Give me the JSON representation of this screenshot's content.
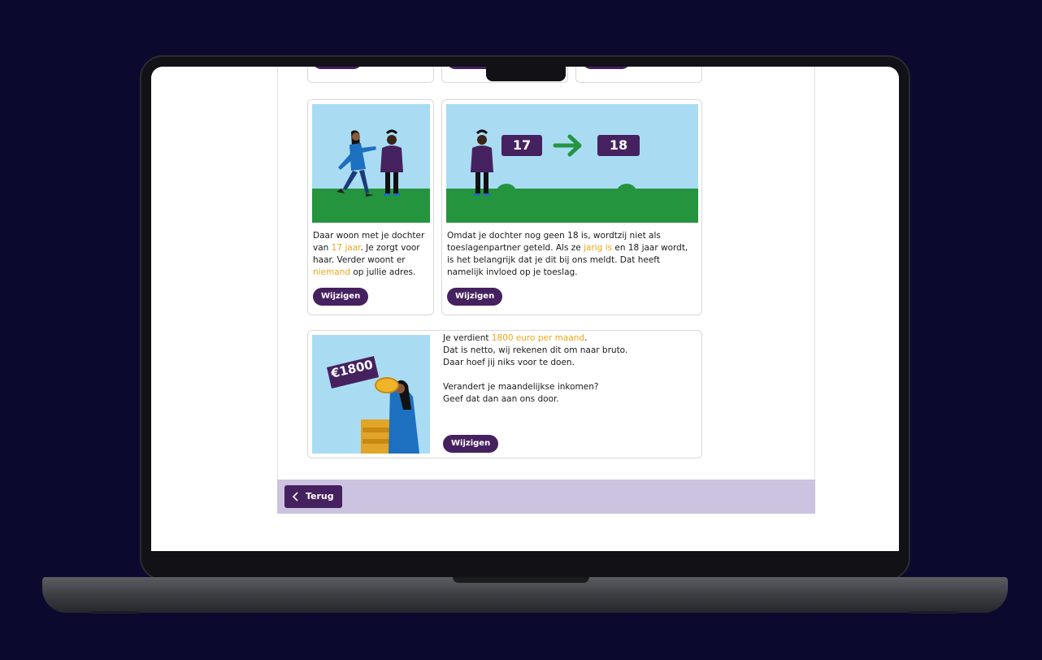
{
  "cards": [
    {
      "id": "daughter",
      "text": {
        "p1": "Daar woon met je dochter van ",
        "hl1": "17 jaar",
        "p2": ". Je zorgt voor haar. Verder woont er ",
        "hl2": "niemand",
        "p3": " op jullie adres."
      },
      "button": "Wijzigen"
    },
    {
      "id": "age",
      "image_labels": {
        "from": "17",
        "to": "18"
      },
      "text": {
        "p1": "Omdat je dochter nog geen 18 is, wordtzij niet als toeslagenpartner geteld. Als ze ",
        "hl1": "jarig is",
        "p2": " en 18 jaar wordt, is het belangrijk dat je dit bij ons meldt. Dat heeft namelijk invloed op je toeslag."
      },
      "button": "Wijzigen"
    },
    {
      "id": "income",
      "image_label": "€1800",
      "text": {
        "p1": "Je verdient ",
        "hl1": "1800 euro per maand",
        "p2": ".",
        "line2": "Dat is netto, wij rekenen dit om naar bruto.",
        "line3": "Daar hoef jij niks voor te doen.",
        "line4": "Verandert je maandelijkse inkomen?",
        "line5": "Geef dat dan aan ons door."
      },
      "button": "Wijzigen"
    }
  ],
  "footer": {
    "back_label": "Terug",
    "back_icon": "chevron-left-icon"
  },
  "colors": {
    "accent": "#46215f",
    "highlight": "#f2a515",
    "sky": "#a9dcf3",
    "grass": "#25943f",
    "footer": "#cbc3e0"
  }
}
